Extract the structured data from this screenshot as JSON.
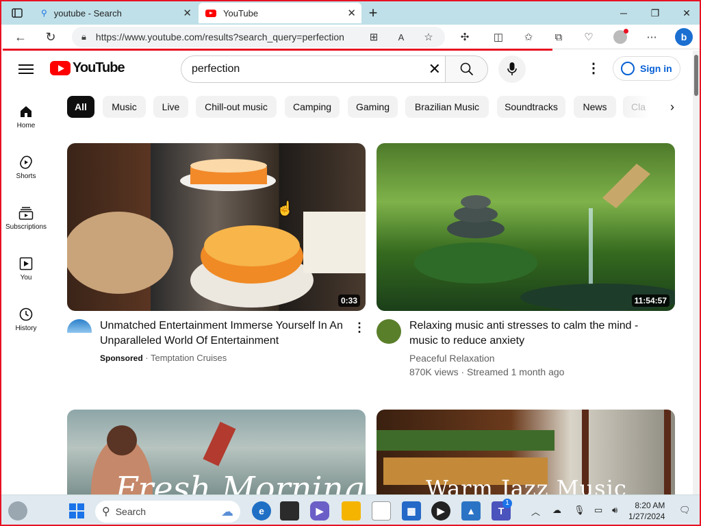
{
  "browser": {
    "tabs": [
      {
        "title": "youtube - Search",
        "active": false
      },
      {
        "title": "YouTube",
        "active": true
      }
    ],
    "url": "https://www.youtube.com/results?search_query=perfection"
  },
  "youtube": {
    "logo_text": "YouTube",
    "search_value": "perfection",
    "signin_label": "Sign in",
    "sidebar": [
      {
        "label": "Home",
        "icon": "home-icon"
      },
      {
        "label": "Shorts",
        "icon": "shorts-icon"
      },
      {
        "label": "Subscriptions",
        "icon": "subscriptions-icon"
      },
      {
        "label": "You",
        "icon": "you-icon"
      },
      {
        "label": "History",
        "icon": "history-icon"
      }
    ],
    "chips": [
      "All",
      "Music",
      "Live",
      "Chill-out music",
      "Camping",
      "Gaming",
      "Brazilian Music",
      "Soundtracks",
      "News",
      "Cla"
    ],
    "videos": [
      {
        "title_line1": "Unmatched Entertainment Immerse Yourself In An",
        "title_line2": "Unparalleled World Of Entertainment",
        "sponsored": "Sponsored",
        "channel": "· Temptation Cruises",
        "duration": "0:33"
      },
      {
        "title_line1": "Relaxing music anti stresses to calm the mind -",
        "title_line2": "music to reduce anxiety",
        "channel": "Peaceful Relaxation",
        "stats": "870K views · Streamed 1 month ago",
        "duration": "11:54:57"
      },
      {
        "overlay_text": "Fresh Morning"
      },
      {
        "overlay_text": "Warm Jazz Music"
      }
    ]
  },
  "taskbar": {
    "search_label": "Search",
    "teams_badge": "1",
    "time": "8:20 AM",
    "date": "1/27/2024"
  },
  "colors": {
    "accent": "#ff0000",
    "link": "#065fd4",
    "frame": "#e81123"
  }
}
